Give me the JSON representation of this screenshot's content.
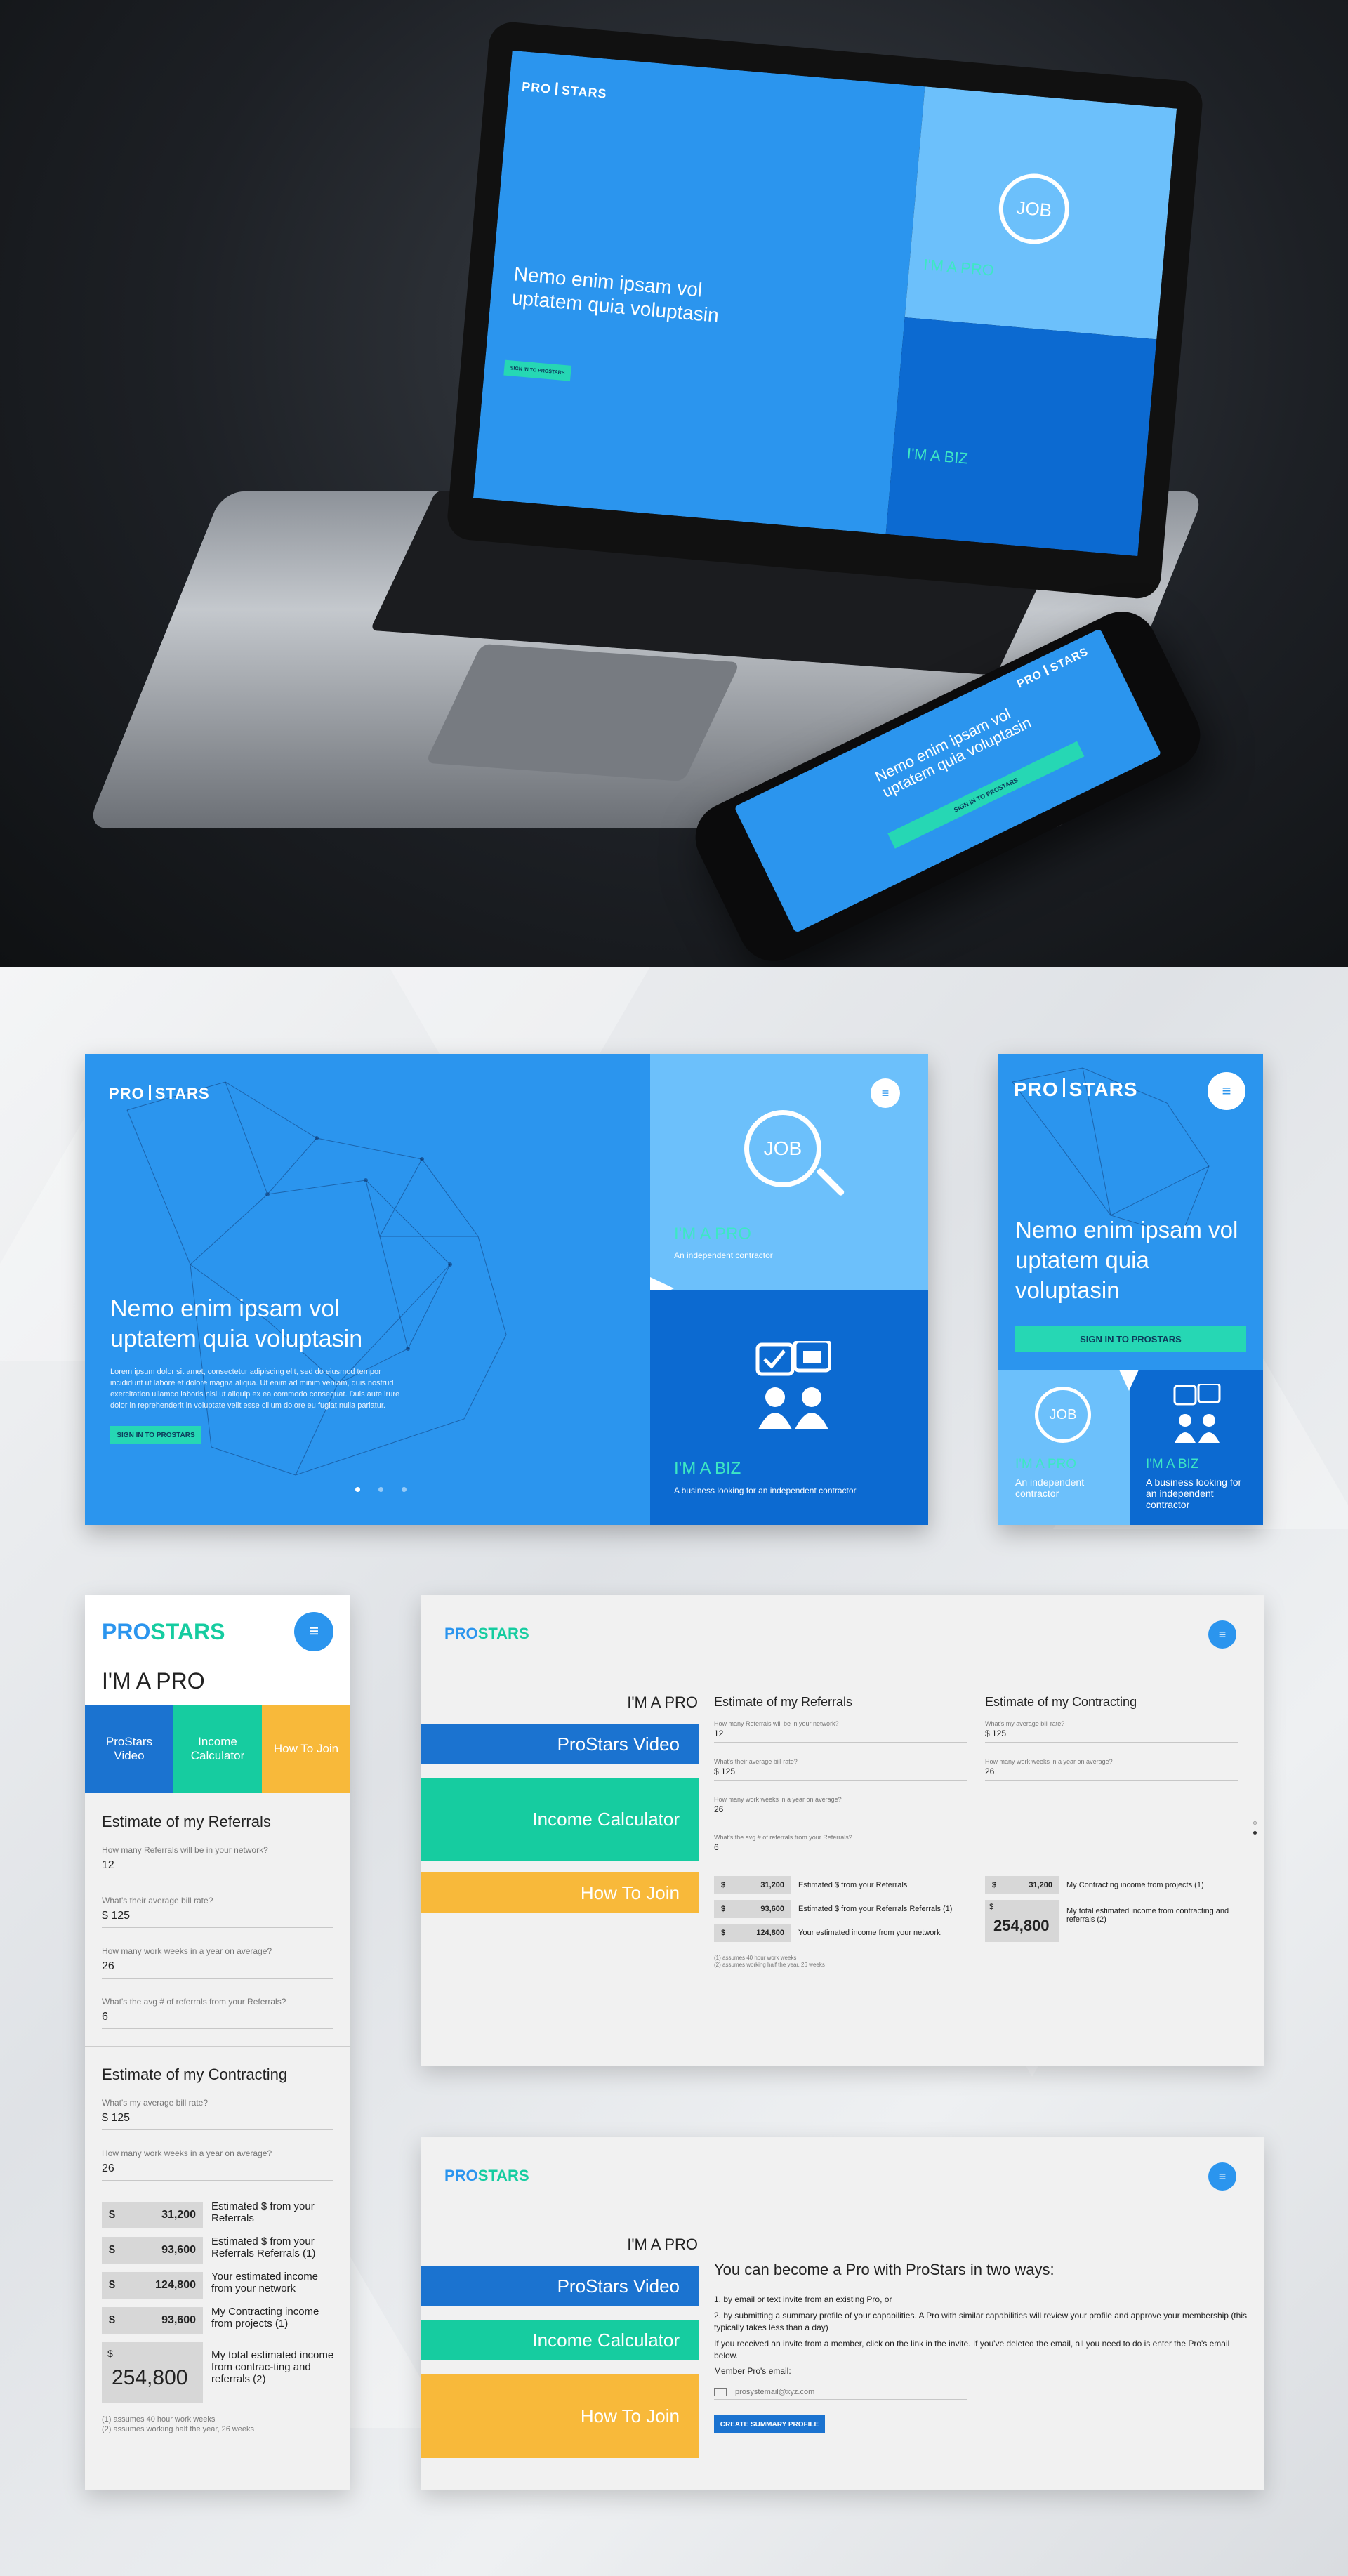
{
  "brand": {
    "name_left": "PRO",
    "name_right": "STARS"
  },
  "hero_slide": {
    "headline": "Nemo enim ipsam  vol uptatem quia voluptasin",
    "headline_mobile": "Nemo enim ipsam vol uptatem quia voluptasin",
    "body": "Lorem ipsum dolor sit amet, consectetur adipiscing elit, sed do eiusmod tempor incididunt ut labore et dolore magna aliqua. Ut enim ad minim veniam, quis nostrud exercitation ullamco laboris nisi ut aliquip ex ea commodo consequat. Duis aute irure dolor in reprehenderit in voluptate velit esse cillum dolore eu fugiat nulla pariatur.",
    "cta": "SIGN IN TO PROSTARS",
    "cta_mobile": "SIGN IN TO PROSTARS"
  },
  "pro_card": {
    "icon_text": "JOB",
    "title": "I'M A PRO",
    "subtitle": "An independent contractor"
  },
  "biz_card": {
    "title": "I'M A BIZ",
    "subtitle": "A business looking for an independent contractor"
  },
  "calc_mobile": {
    "page_title": "I'M A PRO",
    "tabs": [
      "ProStars Video",
      "Income Calculator",
      "How To Join"
    ],
    "referrals": {
      "heading": "Estimate of my Referrals",
      "q1": "How many Referrals will be in your network?",
      "a1": "12",
      "q2": "What's their average bill rate?",
      "a2": "$ 125",
      "q3": "How many work weeks in a year on average?",
      "a3": "26",
      "q4": "What's the avg # of referrals from your Referrals?",
      "a4": "6"
    },
    "contracting": {
      "heading": "Estimate of my Contracting",
      "q1": "What's my average bill rate?",
      "a1": "$ 125",
      "q2": "How many work weeks in a year on average?",
      "a2": "26"
    },
    "results": [
      {
        "cur": "$",
        "val": "31,200",
        "label": "Estimated $ from your Referrals"
      },
      {
        "cur": "$",
        "val": "93,600",
        "label": "Estimated $ from your Referrals Referrals (1)"
      },
      {
        "cur": "$",
        "val": "124,800",
        "label": "Your estimated income from your network"
      },
      {
        "cur": "$",
        "val": "93,600",
        "label": "My Contracting income from projects (1)"
      }
    ],
    "total": {
      "cur": "$",
      "val": "254,800",
      "label": "My total estimated income from contrac-ting and referrals (2)"
    },
    "notes": [
      "(1) assumes 40 hour work weeks",
      "(2) assumes working half the year, 26 weeks"
    ]
  },
  "calc_desktop": {
    "page_title": "I'M A PRO",
    "nav": [
      "ProStars Video",
      "Income Calculator",
      "How To Join"
    ],
    "referrals": {
      "heading": "Estimate of my Referrals",
      "q1": "How many Referrals will be in your network?",
      "a1": "12",
      "q2": "What's their average bill rate?",
      "a2": "$ 125",
      "q3": "How many work weeks in a year on average?",
      "a3": "26",
      "q4": "What's the avg # of referrals from your Referrals?",
      "a4": "6"
    },
    "contracting": {
      "heading": "Estimate of my Contracting",
      "q1": "What's my average bill rate?",
      "a1": "$ 125",
      "q2": "How many work weeks in a year on average?",
      "a2": "26"
    },
    "results": [
      {
        "cur": "$",
        "val": "31,200",
        "label": "Estimated $ from your Referrals"
      },
      {
        "cur": "$",
        "val": "93,600",
        "label": "Estimated $ from your Referrals Referrals (1)"
      },
      {
        "cur": "$",
        "val": "124,800",
        "label": "Your estimated income from your network"
      }
    ],
    "contract_result": {
      "cur": "$",
      "val": "31,200",
      "label": "My Contracting income from projects (1)"
    },
    "total": {
      "cur": "$",
      "val": "254,800",
      "label": "My total estimated income from contracting and referrals (2)"
    },
    "notes": [
      "(1) assumes 40 hour work weeks",
      "(2) assumes working half the year, 26 weeks"
    ]
  },
  "join_desktop": {
    "page_title": "I'M A PRO",
    "nav": [
      "ProStars Video",
      "Income Calculator",
      "How To Join"
    ],
    "heading": "You can become a Pro with ProStars in two ways:",
    "p1": "1. by email or text invite from an existing Pro, or",
    "p2": "2. by submitting a summary profile of your capabilities. A Pro with similar capabilities will review your profile and approve your membership (this typically takes less than a day)",
    "p3": "If you received an invite from a member, click on the link in the invite. If you've deleted the email, all you need to do is enter the Pro's email below.",
    "email_label": "Member Pro's email:",
    "email_placeholder": "prosystemail@xyz.com",
    "button": "CREATE SUMMARY PROFILE"
  },
  "colors": {
    "blue": "#2b95ee",
    "dark_blue": "#0c6ad1",
    "light_blue": "#6cc0fb",
    "teal": "#16cca0",
    "yellow": "#f8b93a",
    "nav_blue": "#1b73d0"
  }
}
